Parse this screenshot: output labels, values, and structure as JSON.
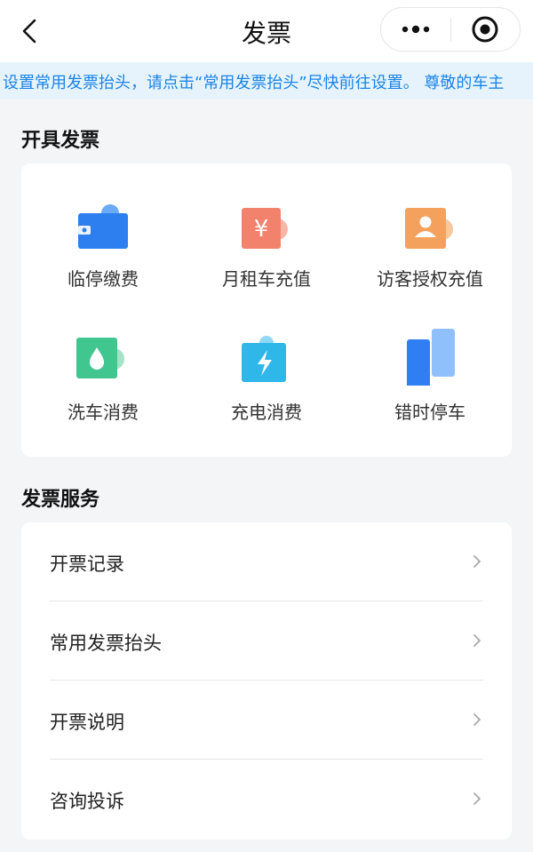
{
  "nav": {
    "title": "发票"
  },
  "notice": {
    "text": "设置常用发票抬头，请点击“常用发票抬头”尽快前往设置。    尊敬的车主"
  },
  "issue_section": {
    "title": "开具发票",
    "items": [
      {
        "label": "临停缴费",
        "icon": "wallet-icon",
        "color": "#2d7ff0"
      },
      {
        "label": "月租车充值",
        "icon": "yuan-icon",
        "color": "#f2826b"
      },
      {
        "label": "访客授权充值",
        "icon": "visitor-icon",
        "color": "#f3a15c"
      },
      {
        "label": "洗车消费",
        "icon": "water-drop-icon",
        "color": "#41c690"
      },
      {
        "label": "充电消费",
        "icon": "lightning-icon",
        "color": "#2fb7e9"
      },
      {
        "label": "错时停车",
        "icon": "bars-icon",
        "color": "#2f7ff2"
      }
    ]
  },
  "service_section": {
    "title": "发票服务",
    "items": [
      {
        "label": "开票记录"
      },
      {
        "label": "常用发票抬头"
      },
      {
        "label": "开票说明"
      },
      {
        "label": "咨询投诉"
      }
    ]
  }
}
